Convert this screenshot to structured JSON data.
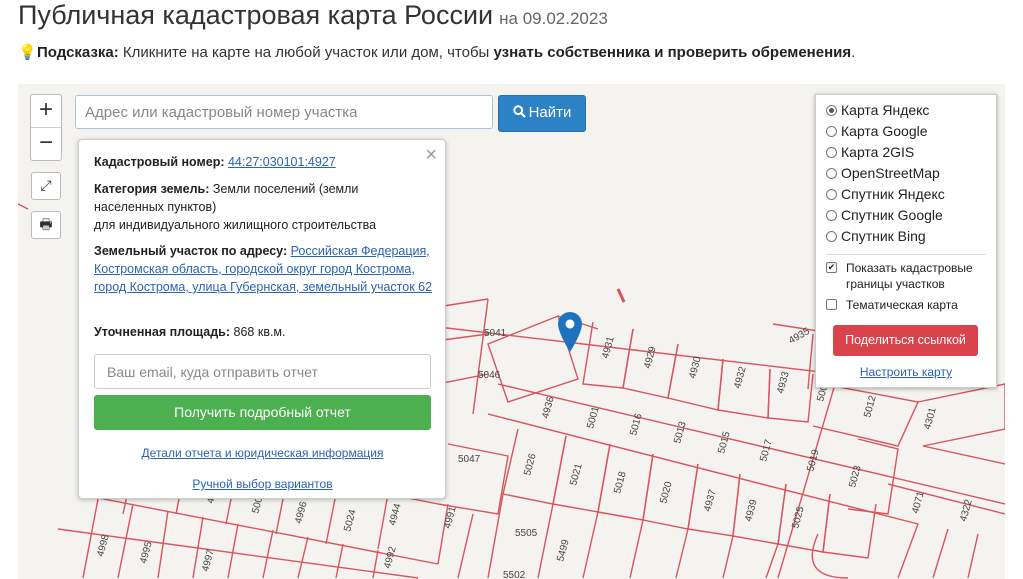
{
  "header": {
    "title": "Публичная кадастровая карта России",
    "date": "на 09.02.2023"
  },
  "hint": {
    "label": "Подсказка:",
    "text": " Кликните на карте на любой участок или дом, чтобы ",
    "emphasis": "узнать собственника и проверить обременения",
    "end": "."
  },
  "toolbar": {
    "zoom_in": "+",
    "zoom_out": "−",
    "fullscreen_icon": "⤢",
    "print_icon": "🖶"
  },
  "search": {
    "placeholder": "Адрес или кадастровый номер участка",
    "value": "",
    "button_label": "Найти"
  },
  "popup": {
    "close": "×",
    "cadastral_label": "Кадастровый номер:",
    "cadastral_number": "44:27:030101:4927",
    "category_label": "Категория земель:",
    "category_value": "Земли поселений (земли населенных пунктов)",
    "category_use": "для индивидуального жилищного строительства",
    "address_label": "Земельный участок по адресу:",
    "address_value": "Российская Федерация, Костромская область, городской округ город Кострома, город Кострома, улица Губернская, земельный участок 62",
    "area_label": "Уточненная площадь:",
    "area_value": "868 кв.м.",
    "email_placeholder": "Ваш email, куда отправить отчет",
    "report_button": "Получить подробный отчет",
    "details_link": "Детали отчета и юридическая информация",
    "manual_link": "Ручной выбор вариантов"
  },
  "layers": {
    "options": [
      {
        "label": "Карта Яндекс",
        "selected": true
      },
      {
        "label": "Карта Google",
        "selected": false
      },
      {
        "label": "Карта 2GIS",
        "selected": false
      },
      {
        "label": "OpenStreetMap",
        "selected": false
      },
      {
        "label": "Спутник Яндекс",
        "selected": false
      },
      {
        "label": "Спутник Google",
        "selected": false
      },
      {
        "label": "Спутник Bing",
        "selected": false
      }
    ],
    "show_borders": {
      "label": "Показать кадастровые границы участков",
      "checked": true
    },
    "thematic": {
      "label": "Тематическая карта",
      "checked": false
    },
    "share_button": "Поделиться ссылкой",
    "setup_link": "Настроить карту"
  },
  "map": {
    "parcel_labels": [
      "5041",
      "5046",
      "4931",
      "4929",
      "4930",
      "4932",
      "4933",
      "4935",
      "5009",
      "5012",
      "4301",
      "4936",
      "5001",
      "5016",
      "5013",
      "5015",
      "5017",
      "5019",
      "5023",
      "5047",
      "5026",
      "5021",
      "5018",
      "5020",
      "4937",
      "4939",
      "5025",
      "4071",
      "4322",
      "4943",
      "4999",
      "5000",
      "4996",
      "5024",
      "4944",
      "4991",
      "5505",
      "5499",
      "4998",
      "4995",
      "4997",
      "5502",
      "4992"
    ],
    "colors": {
      "border": "#d9545c",
      "background": "#f4f3ef",
      "marker": "#1e73be"
    }
  }
}
